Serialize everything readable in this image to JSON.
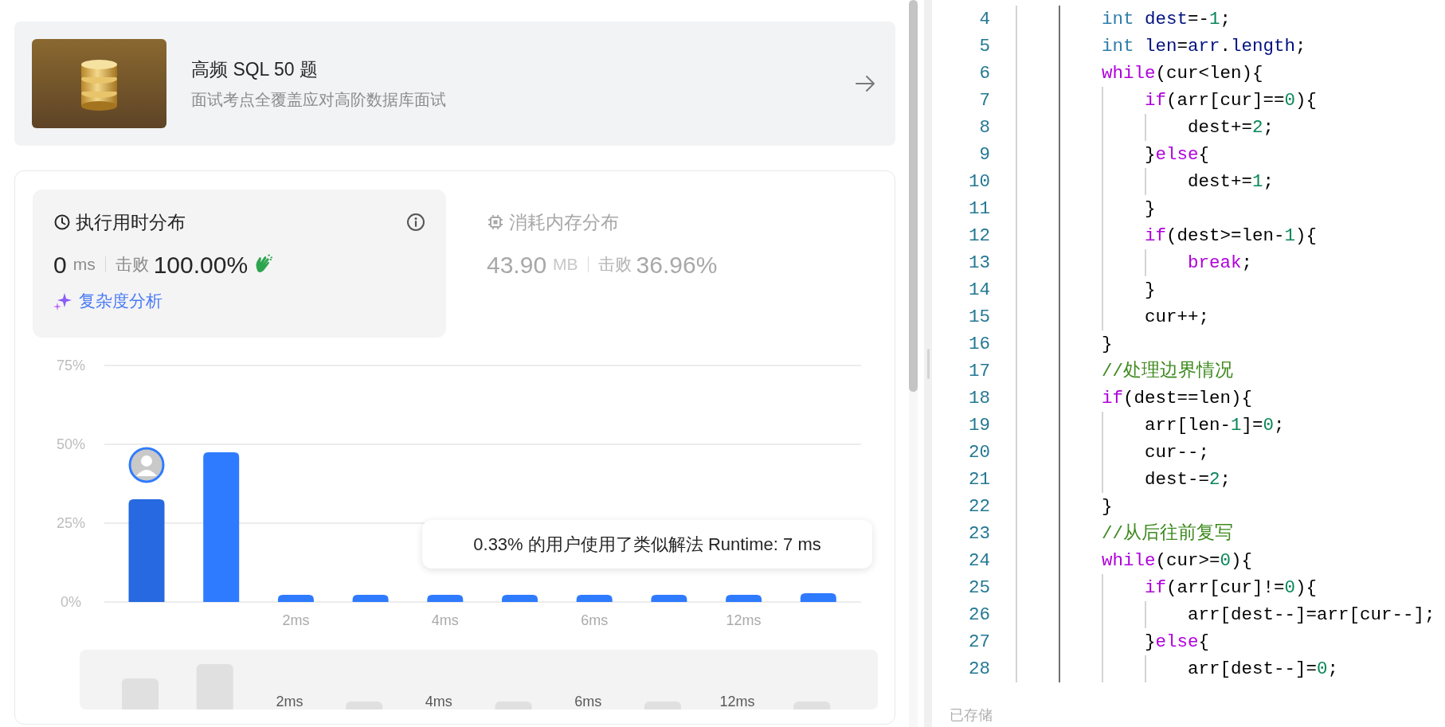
{
  "course": {
    "title": "高频 SQL 50 题",
    "subtitle": "面试考点全覆盖应对高阶数据库面试"
  },
  "stats": [
    {
      "kind": "runtime",
      "selected": true,
      "title": "执行用时分布",
      "value": "0",
      "unit": "ms",
      "beat_label": "击败",
      "beat": "100.00%",
      "link": "复杂度分析"
    },
    {
      "kind": "memory",
      "selected": false,
      "title": "消耗内存分布",
      "value": "43.90",
      "unit": "MB",
      "beat_label": "击败",
      "beat": "36.96%"
    }
  ],
  "chart_data": {
    "type": "bar",
    "categories": [
      null,
      null,
      "2ms",
      null,
      "4ms",
      null,
      "6ms",
      null,
      "12ms",
      null
    ],
    "series": [
      {
        "color": "#2f7bff",
        "values": [
          null,
          47.5,
          2.3,
          2.3,
          2.3,
          2.3,
          2.3,
          2.3,
          2.3,
          2.8
        ]
      },
      {
        "color": "#2669e0",
        "values": [
          32.6,
          null,
          null,
          null,
          null,
          null,
          null,
          null,
          null,
          null
        ]
      }
    ],
    "ylim": [
      0,
      75
    ],
    "yticks": [
      {
        "value": 0,
        "label": "0%"
      },
      {
        "value": 25,
        "label": "25%"
      },
      {
        "value": 50,
        "label": "50%"
      },
      {
        "value": 75,
        "label": "75%"
      }
    ],
    "stacked": true
  },
  "tooltip": "0.33% 的用户使用了类似解法 Runtime: 7 ms",
  "overview": {
    "labels": [
      "2ms",
      "4ms",
      "6ms",
      "12ms"
    ]
  },
  "editor": {
    "lines": [
      {
        "number": "4",
        "tokens": [
          {
            "text": "        int ",
            "kind": "type"
          },
          {
            "text": "dest",
            "kind": "var"
          },
          {
            "text": "=-",
            "kind": "plain"
          },
          {
            "text": "1",
            "kind": "num"
          },
          {
            "text": ";",
            "kind": "plain"
          }
        ]
      },
      {
        "number": "5",
        "tokens": [
          {
            "text": "        int ",
            "kind": "type"
          },
          {
            "text": "len",
            "kind": "var"
          },
          {
            "text": "=",
            "kind": "plain"
          },
          {
            "text": "arr",
            "kind": "var"
          },
          {
            "text": ".",
            "kind": "plain"
          },
          {
            "text": "length",
            "kind": "var"
          },
          {
            "text": ";",
            "kind": "plain"
          }
        ]
      },
      {
        "number": "6",
        "tokens": [
          {
            "text": "        while",
            "kind": "kw"
          },
          {
            "text": "(cur<len){",
            "kind": "plain"
          }
        ]
      },
      {
        "number": "7",
        "tokens": [
          {
            "text": "            if",
            "kind": "kw"
          },
          {
            "text": "(arr[cur]==",
            "kind": "plain"
          },
          {
            "text": "0",
            "kind": "num"
          },
          {
            "text": "){",
            "kind": "plain"
          }
        ]
      },
      {
        "number": "8",
        "tokens": [
          {
            "text": "                dest+=",
            "kind": "plain"
          },
          {
            "text": "2",
            "kind": "num"
          },
          {
            "text": ";",
            "kind": "plain"
          }
        ]
      },
      {
        "number": "9",
        "tokens": [
          {
            "text": "            }",
            "kind": "plain"
          },
          {
            "text": "else",
            "kind": "kw"
          },
          {
            "text": "{",
            "kind": "plain"
          }
        ]
      },
      {
        "number": "10",
        "tokens": [
          {
            "text": "                dest+=",
            "kind": "plain"
          },
          {
            "text": "1",
            "kind": "num"
          },
          {
            "text": ";",
            "kind": "plain"
          }
        ]
      },
      {
        "number": "11",
        "tokens": [
          {
            "text": "            }",
            "kind": "plain"
          }
        ]
      },
      {
        "number": "12",
        "tokens": [
          {
            "text": "            if",
            "kind": "kw"
          },
          {
            "text": "(dest>=len-",
            "kind": "plain"
          },
          {
            "text": "1",
            "kind": "num"
          },
          {
            "text": "){",
            "kind": "plain"
          }
        ]
      },
      {
        "number": "13",
        "tokens": [
          {
            "text": "                break",
            "kind": "kw"
          },
          {
            "text": ";",
            "kind": "plain"
          }
        ]
      },
      {
        "number": "14",
        "tokens": [
          {
            "text": "            }",
            "kind": "plain"
          }
        ]
      },
      {
        "number": "15",
        "tokens": [
          {
            "text": "            cur++;",
            "kind": "plain"
          }
        ]
      },
      {
        "number": "16",
        "tokens": [
          {
            "text": "        }",
            "kind": "plain"
          }
        ]
      },
      {
        "number": "17",
        "tokens": [
          {
            "text": "        //处理边界情况",
            "kind": "comment"
          }
        ]
      },
      {
        "number": "18",
        "tokens": [
          {
            "text": "        if",
            "kind": "kw"
          },
          {
            "text": "(dest==len){",
            "kind": "plain"
          }
        ]
      },
      {
        "number": "19",
        "tokens": [
          {
            "text": "            arr[len-",
            "kind": "plain"
          },
          {
            "text": "1",
            "kind": "num"
          },
          {
            "text": "]=",
            "kind": "plain"
          },
          {
            "text": "0",
            "kind": "num"
          },
          {
            "text": ";",
            "kind": "plain"
          }
        ]
      },
      {
        "number": "20",
        "tokens": [
          {
            "text": "            cur--;",
            "kind": "plain"
          }
        ]
      },
      {
        "number": "21",
        "tokens": [
          {
            "text": "            dest-=",
            "kind": "plain"
          },
          {
            "text": "2",
            "kind": "num"
          },
          {
            "text": ";",
            "kind": "plain"
          }
        ]
      },
      {
        "number": "22",
        "tokens": [
          {
            "text": "        }",
            "kind": "plain"
          }
        ]
      },
      {
        "number": "23",
        "tokens": [
          {
            "text": "        //从后往前复写",
            "kind": "comment"
          }
        ]
      },
      {
        "number": "24",
        "tokens": [
          {
            "text": "        while",
            "kind": "kw"
          },
          {
            "text": "(cur>=",
            "kind": "plain"
          },
          {
            "text": "0",
            "kind": "num"
          },
          {
            "text": "){",
            "kind": "plain"
          }
        ]
      },
      {
        "number": "25",
        "tokens": [
          {
            "text": "            if",
            "kind": "kw"
          },
          {
            "text": "(arr[cur]!=",
            "kind": "plain"
          },
          {
            "text": "0",
            "kind": "num"
          },
          {
            "text": "){",
            "kind": "plain"
          }
        ]
      },
      {
        "number": "26",
        "tokens": [
          {
            "text": "                arr[dest--]=arr[cur--];",
            "kind": "plain"
          }
        ]
      },
      {
        "number": "27",
        "tokens": [
          {
            "text": "            }",
            "kind": "plain"
          },
          {
            "text": "else",
            "kind": "kw"
          },
          {
            "text": "{",
            "kind": "plain"
          }
        ]
      },
      {
        "number": "28",
        "tokens": [
          {
            "text": "                arr[dest--]=",
            "kind": "plain"
          },
          {
            "text": "0",
            "kind": "num"
          },
          {
            "text": ";",
            "kind": "plain"
          }
        ]
      }
    ]
  },
  "save_status": "已存储"
}
